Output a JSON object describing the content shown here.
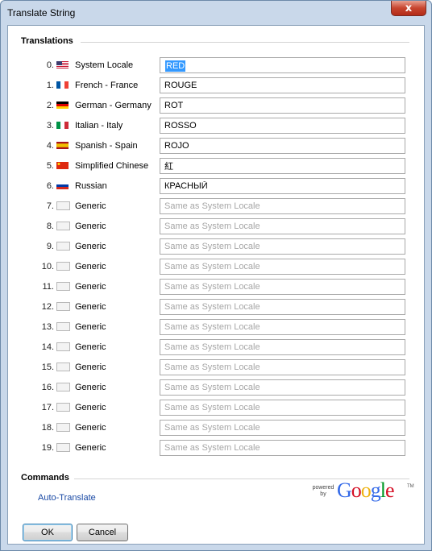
{
  "window": {
    "title": "Translate String",
    "close_glyph": "x"
  },
  "translations": {
    "section_label": "Translations",
    "rows": [
      {
        "index": "0.",
        "language": "System Locale",
        "flag": "us-flag-icon",
        "value": "RED",
        "placeholder": ""
      },
      {
        "index": "1.",
        "language": "French - France",
        "flag": "france-flag-icon",
        "value": "ROUGE",
        "placeholder": ""
      },
      {
        "index": "2.",
        "language": "German - Germany",
        "flag": "germany-flag-icon",
        "value": "ROT",
        "placeholder": ""
      },
      {
        "index": "3.",
        "language": "Italian - Italy",
        "flag": "italy-flag-icon",
        "value": "ROSSO",
        "placeholder": ""
      },
      {
        "index": "4.",
        "language": "Spanish - Spain",
        "flag": "spain-flag-icon",
        "value": "ROJO",
        "placeholder": ""
      },
      {
        "index": "5.",
        "language": "Simplified Chinese",
        "flag": "china-flag-icon",
        "value": "紅",
        "placeholder": ""
      },
      {
        "index": "6.",
        "language": "Russian",
        "flag": "russia-flag-icon",
        "value": "КРАСНЫЙ",
        "placeholder": ""
      },
      {
        "index": "7.",
        "language": "Generic",
        "flag": "blank-flag-icon",
        "value": "",
        "placeholder": "Same as System Locale"
      },
      {
        "index": "8.",
        "language": "Generic",
        "flag": "blank-flag-icon",
        "value": "",
        "placeholder": "Same as System Locale"
      },
      {
        "index": "9.",
        "language": "Generic",
        "flag": "blank-flag-icon",
        "value": "",
        "placeholder": "Same as System Locale"
      },
      {
        "index": "10.",
        "language": "Generic",
        "flag": "blank-flag-icon",
        "value": "",
        "placeholder": "Same as System Locale"
      },
      {
        "index": "11.",
        "language": "Generic",
        "flag": "blank-flag-icon",
        "value": "",
        "placeholder": "Same as System Locale"
      },
      {
        "index": "12.",
        "language": "Generic",
        "flag": "blank-flag-icon",
        "value": "",
        "placeholder": "Same as System Locale"
      },
      {
        "index": "13.",
        "language": "Generic",
        "flag": "blank-flag-icon",
        "value": "",
        "placeholder": "Same as System Locale"
      },
      {
        "index": "14.",
        "language": "Generic",
        "flag": "blank-flag-icon",
        "value": "",
        "placeholder": "Same as System Locale"
      },
      {
        "index": "15.",
        "language": "Generic",
        "flag": "blank-flag-icon",
        "value": "",
        "placeholder": "Same as System Locale"
      },
      {
        "index": "16.",
        "language": "Generic",
        "flag": "blank-flag-icon",
        "value": "",
        "placeholder": "Same as System Locale"
      },
      {
        "index": "17.",
        "language": "Generic",
        "flag": "blank-flag-icon",
        "value": "",
        "placeholder": "Same as System Locale"
      },
      {
        "index": "18.",
        "language": "Generic",
        "flag": "blank-flag-icon",
        "value": "",
        "placeholder": "Same as System Locale"
      },
      {
        "index": "19.",
        "language": "Generic",
        "flag": "blank-flag-icon",
        "value": "",
        "placeholder": "Same as System Locale"
      }
    ]
  },
  "commands": {
    "section_label": "Commands",
    "auto_translate_label": "Auto-Translate",
    "powered_by_text": "powered by",
    "google_logo_text": "Google",
    "trademark": "TM"
  },
  "buttons": {
    "ok_label": "OK",
    "cancel_label": "Cancel"
  },
  "colors": {
    "selection": "#3399ff",
    "link": "#1a4aa5",
    "window_frame": "#c9d8ea"
  }
}
